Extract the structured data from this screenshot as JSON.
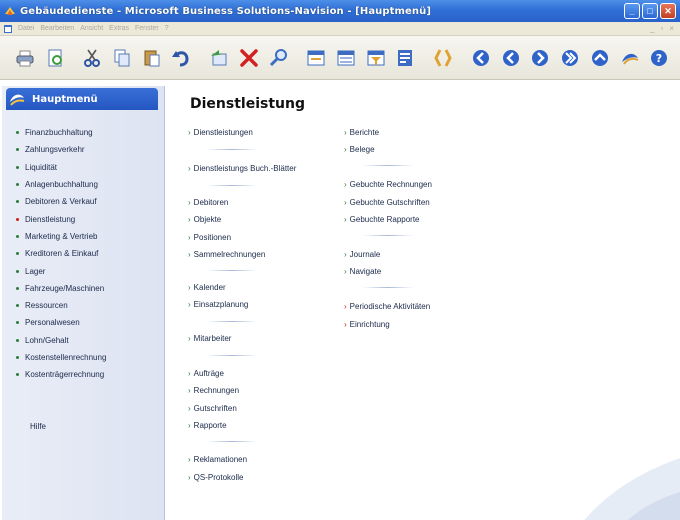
{
  "window": {
    "title": "Gebäudedienste - Microsoft Business Solutions-Navision - [Hauptmenü]"
  },
  "menubar": {
    "items": [
      "Datei",
      "Bearbeiten",
      "Ansicht",
      "Extras",
      "Fenster",
      "?"
    ]
  },
  "sidebar": {
    "title": "Hauptmenü",
    "items": [
      "Finanzbuchhaltung",
      "Zahlungsverkehr",
      "Liquidität",
      "Anlagenbuchhaltung",
      "Debitoren & Verkauf",
      "Dienstleistung",
      "Marketing & Vertrieb",
      "Kreditoren & Einkauf",
      "Lager",
      "Fahrzeuge/Maschinen",
      "Ressourcen",
      "Personalwesen",
      "Lohn/Gehalt",
      "Kostenstellenrechnung",
      "Kostenträgerrechnung"
    ],
    "active": "Dienstleistung",
    "help": "Hilfe"
  },
  "main": {
    "title": "Dienstleistung",
    "col1": [
      "Dienstleistungen",
      "Dienstleistungs Buch.-Blätter",
      "Debitoren",
      "Objekte",
      "Positionen",
      "Sammelrechnungen",
      "Kalender",
      "Einsatzplanung",
      "Mitarbeiter",
      "Aufträge",
      "Rechnungen",
      "Gutschriften",
      "Rapporte",
      "Reklamationen",
      "QS-Protokolle"
    ],
    "col2": [
      "Berichte",
      "Belege",
      "Gebuchte Rechnungen",
      "Gebuchte Gutschriften",
      "Gebuchte Rapporte",
      "Journale",
      "Navigate",
      "Periodische Aktivitäten",
      "Einrichtung"
    ]
  },
  "colors": {
    "titlebar": "#2f6fd6",
    "sidebar_header": "#2456c2",
    "bullet": "#2f7c3a",
    "active_bullet": "#d01b1b"
  }
}
